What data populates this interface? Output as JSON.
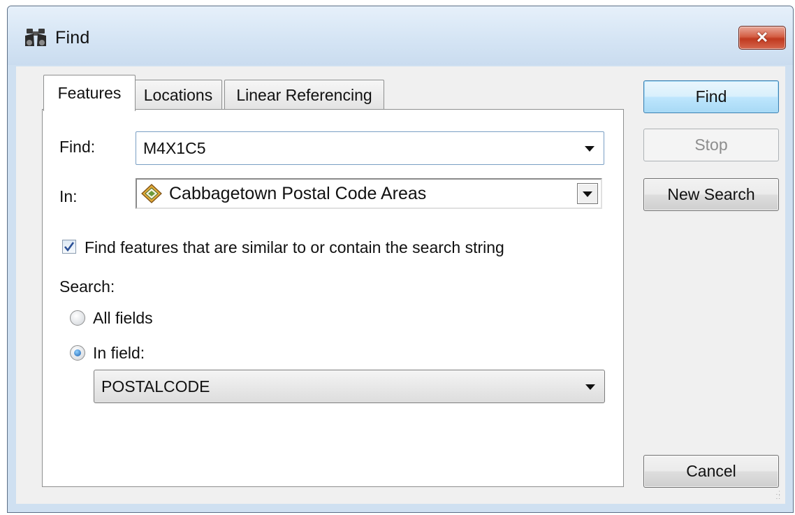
{
  "window": {
    "title": "Find",
    "title_icon": "binoculars-icon",
    "close_icon": "close-icon",
    "close_glyph": "✕"
  },
  "tabs": [
    {
      "label": "Features",
      "active": true
    },
    {
      "label": "Locations",
      "active": false
    },
    {
      "label": "Linear Referencing",
      "active": false
    }
  ],
  "form": {
    "find_label": "Find:",
    "find_value": "M4X1C5",
    "in_label": "In:",
    "in_value": "Cabbagetown Postal Code Areas",
    "in_icon": "feature-layer-icon",
    "similar_checkbox_label": "Find features that are similar to or contain the search string",
    "similar_checked": true,
    "search_label": "Search:",
    "all_fields_label": "All fields",
    "all_fields_selected": false,
    "in_field_label": "In field:",
    "in_field_selected": true,
    "field_value": "POSTALCODE"
  },
  "buttons": {
    "find": "Find",
    "stop": "Stop",
    "new_search": "New Search",
    "cancel": "Cancel"
  },
  "colors": {
    "frame": "#cfe0f1",
    "close_red": "#c0391f",
    "focus_blue": "#3c7fb1"
  }
}
